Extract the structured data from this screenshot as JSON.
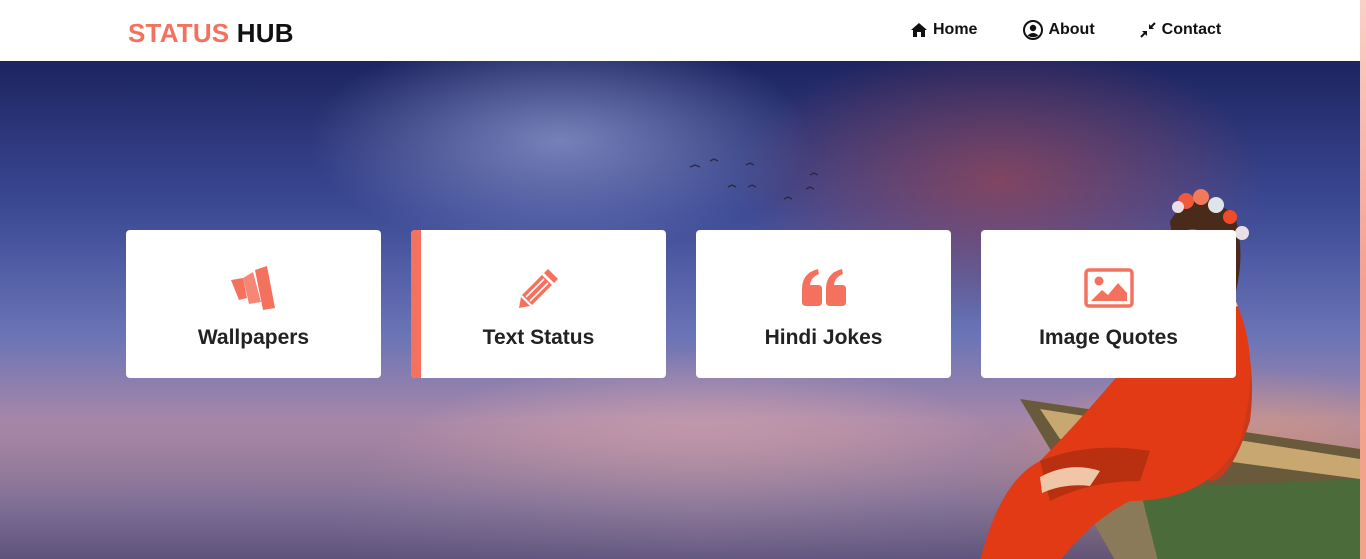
{
  "brand": {
    "part1": "STATUS",
    "part2": "HUB"
  },
  "nav": [
    {
      "label": "Home",
      "icon": "home-icon"
    },
    {
      "label": "About",
      "icon": "user-circle-icon"
    },
    {
      "label": "Contact",
      "icon": "compress-arrows-icon"
    }
  ],
  "cards": [
    {
      "label": "Wallpapers",
      "icon": "wallpaper-logo-icon"
    },
    {
      "label": "Text Status",
      "icon": "pencil-icon"
    },
    {
      "label": "Hindi Jokes",
      "icon": "quote-icon"
    },
    {
      "label": "Image Quotes",
      "icon": "image-icon"
    }
  ],
  "colors": {
    "accent": "#f4715e",
    "text": "#222222",
    "nav_bg": "#ffffff"
  }
}
